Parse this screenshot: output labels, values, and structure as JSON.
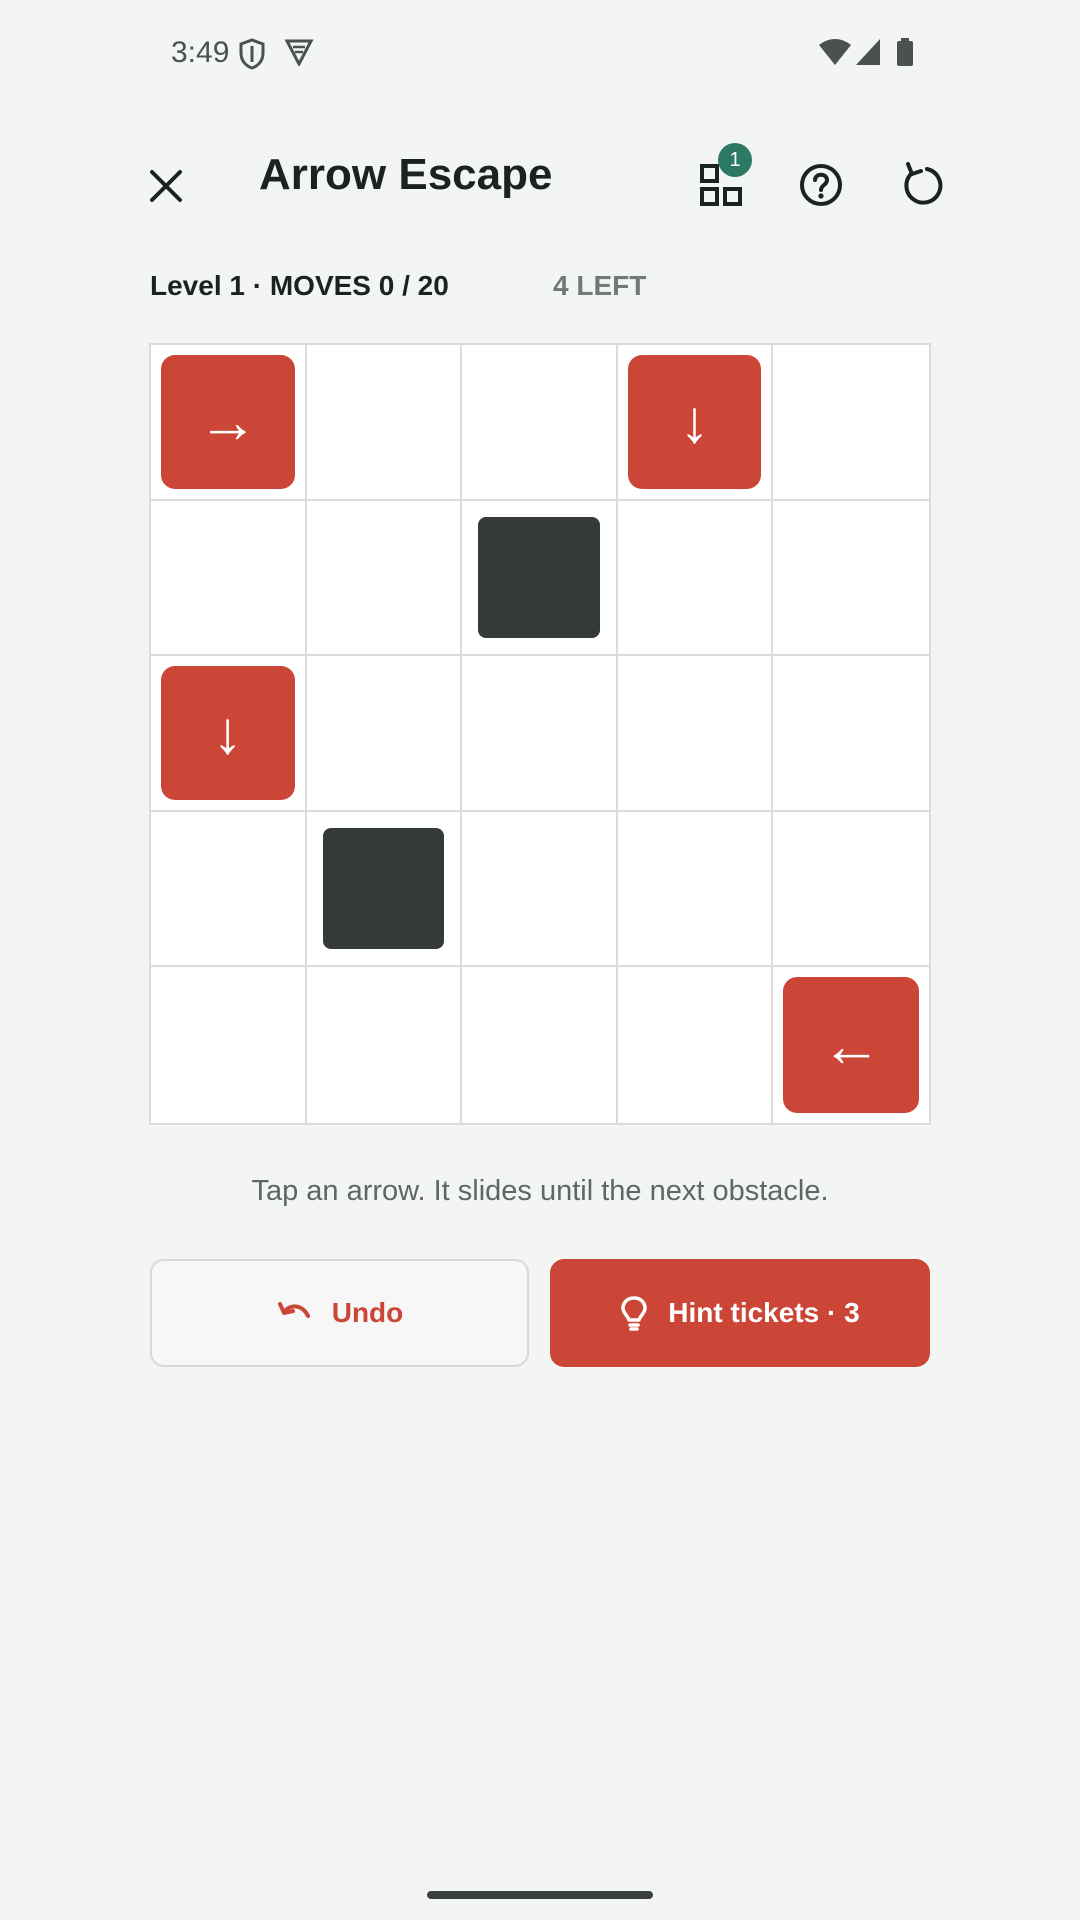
{
  "status_bar": {
    "time": "3:49",
    "left_icons": [
      "shield-icon",
      "vpn-icon"
    ],
    "right_icons": [
      "wifi-icon",
      "cell-signal-icon",
      "battery-icon"
    ]
  },
  "header": {
    "title": "Arrow Escape",
    "close_icon": "close-icon",
    "levels_icon": "grid-icon",
    "levels_badge": "1",
    "help_icon": "help-icon",
    "restart_icon": "restart-icon"
  },
  "stats": {
    "level_moves": "Level 1 · MOVES 0 / 20",
    "left": "4 LEFT"
  },
  "board": {
    "rows": 5,
    "cols": 5,
    "cells": [
      [
        "→",
        "",
        "",
        "↓",
        ""
      ],
      [
        "",
        "",
        "#",
        "",
        ""
      ],
      [
        "↓",
        "",
        "",
        "",
        ""
      ],
      [
        "",
        "#",
        "",
        "",
        ""
      ],
      [
        "",
        "",
        "",
        "",
        "←"
      ]
    ]
  },
  "instruction": "Tap an arrow. It slides until the next obstacle.",
  "buttons": {
    "undo_label": "Undo",
    "hint_label": "Hint tickets · 3"
  },
  "colors": {
    "accent": "#cb4636",
    "block": "#343a39",
    "badge": "#2c7a63",
    "background": "#f3f5f3"
  }
}
